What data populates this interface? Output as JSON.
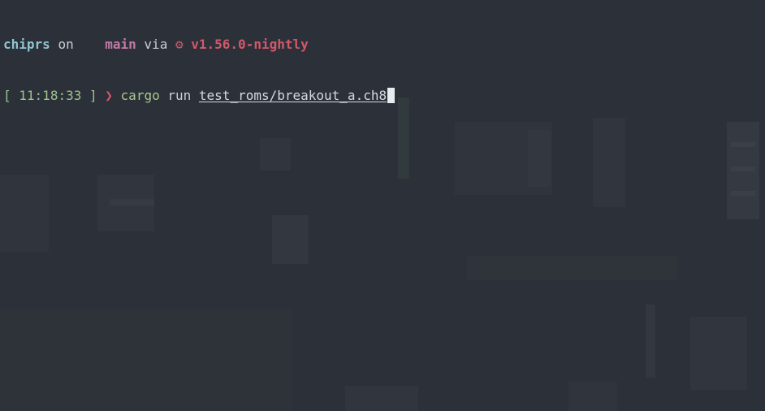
{
  "prompt": {
    "dir": "chiprs",
    "on_word": "on",
    "branch_icon": "git-branch-icon",
    "branch": "main",
    "via_word": "via",
    "rust_icon": "rust-gear-icon",
    "rust_icon_glyph": "⚙",
    "rust_version": "v1.56.0-nightly"
  },
  "line2": {
    "time_open": "[",
    "time": "11:18:33",
    "time_close": "]",
    "chevron": "❯",
    "command": "cargo",
    "subcommand": "run",
    "argument": "test_roms/breakout_a.ch8"
  },
  "colors": {
    "background": "#2c3039",
    "dir": "#8fc5d2",
    "branch": "#c17ba6",
    "rust": "#d3586a",
    "time": "#9cc48a",
    "command": "#a8c98d"
  }
}
